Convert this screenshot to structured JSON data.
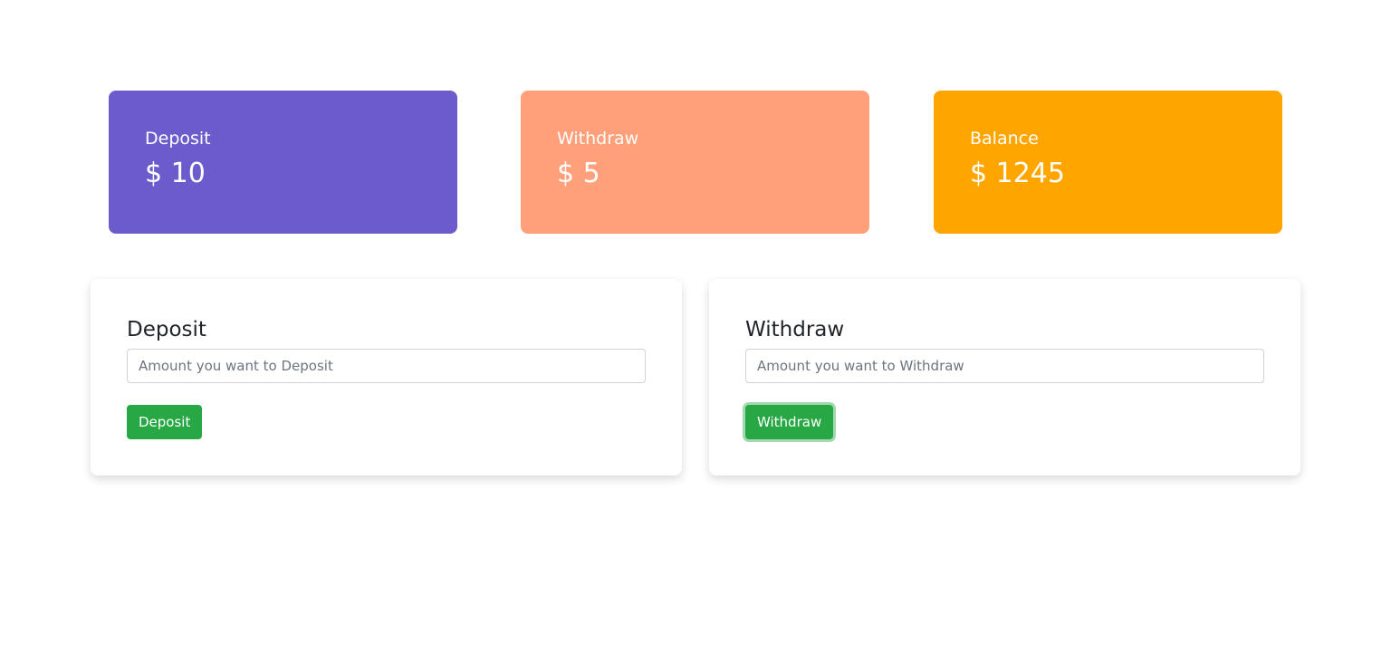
{
  "stats": {
    "deposit": {
      "label": "Deposit",
      "value": "$ 10"
    },
    "withdraw": {
      "label": "Withdraw",
      "value": "$ 5"
    },
    "balance": {
      "label": "Balance",
      "value": "$ 1245"
    }
  },
  "forms": {
    "deposit": {
      "title": "Deposit",
      "placeholder": "Amount you want to Deposit",
      "button_label": "Deposit"
    },
    "withdraw": {
      "title": "Withdraw",
      "placeholder": "Amount you want to Withdraw",
      "button_label": "Withdraw"
    }
  },
  "colors": {
    "deposit_card": "#6b5bcc",
    "withdraw_card": "#ffa07a",
    "balance_card": "#ffa500",
    "button": "#28a745"
  }
}
